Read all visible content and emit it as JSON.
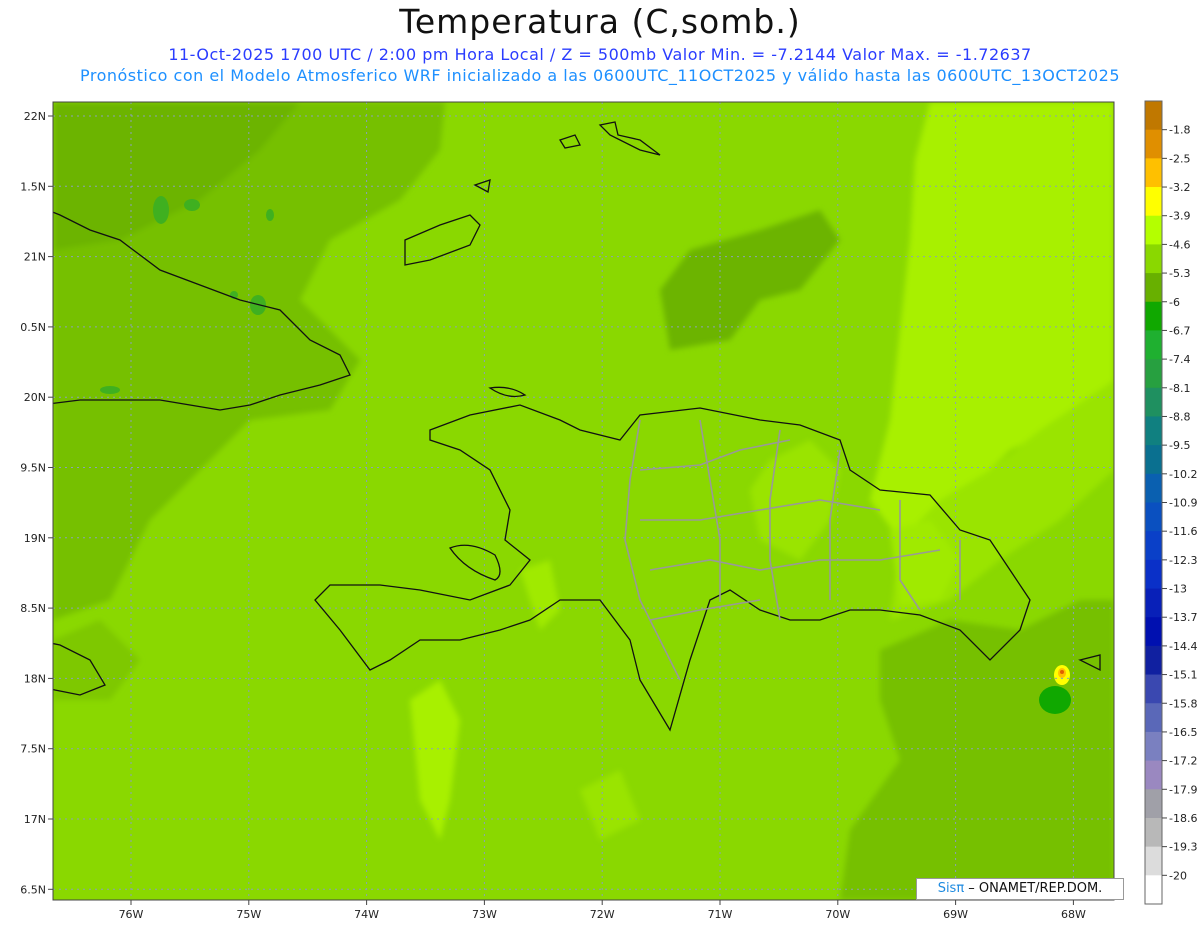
{
  "title": "Temperatura (C,somb.)",
  "subtitle_line1": "11-Oct-2025  1700 UTC / 2:00 pm Hora Local / Z = 500mb   Valor Min. = -7.2144  Valor Max. = -1.72637",
  "subtitle_line2": "Pronóstico con el Modelo Atmosferico WRF inicializado a las 0600UTC_11OCT2025 y válido hasta las  0600UTC_13OCT2025",
  "credit": {
    "brand": "Sisπ",
    "text": " – ONAMET/REP.DOM."
  },
  "map": {
    "lat_ticks": [
      "22N",
      "1.5N",
      "21N",
      "0.5N",
      "20N",
      "9.5N",
      "19N",
      "8.5N",
      "18N",
      "7.5N",
      "17N",
      "6.5N"
    ],
    "lon_ticks": [
      "76W",
      "75W",
      "74W",
      "73W",
      "72W",
      "71W",
      "70W",
      "69W",
      "68W"
    ]
  },
  "colorbar": {
    "labels": [
      "-1.8",
      "-2.5",
      "-3.2",
      "-3.9",
      "-4.6",
      "-5.3",
      "-6",
      "-6.7",
      "-7.4",
      "-8.1",
      "-8.8",
      "-9.5",
      "-10.2",
      "-10.9",
      "-11.6",
      "-12.3",
      "-13",
      "-13.7",
      "-14.4",
      "-15.1",
      "-15.8",
      "-16.5",
      "-17.2",
      "-17.9",
      "-18.6",
      "-19.3",
      "-20"
    ],
    "colors": [
      "#c07800",
      "#e08f00",
      "#ffc000",
      "#ffff00",
      "#b4ff00",
      "#8ad800",
      "#68b000",
      "#10a800",
      "#1fb030",
      "#27a040",
      "#1f9060",
      "#108080",
      "#0a7090",
      "#0a60b0",
      "#0a50c0",
      "#0a40c8",
      "#0a30c8",
      "#0820b8",
      "#0010b0",
      "#1020a0",
      "#3a48b0",
      "#5a68b8",
      "#7a80c0",
      "#9a88c0",
      "#a0a0a8",
      "#b8b8b8",
      "#dcdcdc",
      "#ffffff"
    ]
  }
}
